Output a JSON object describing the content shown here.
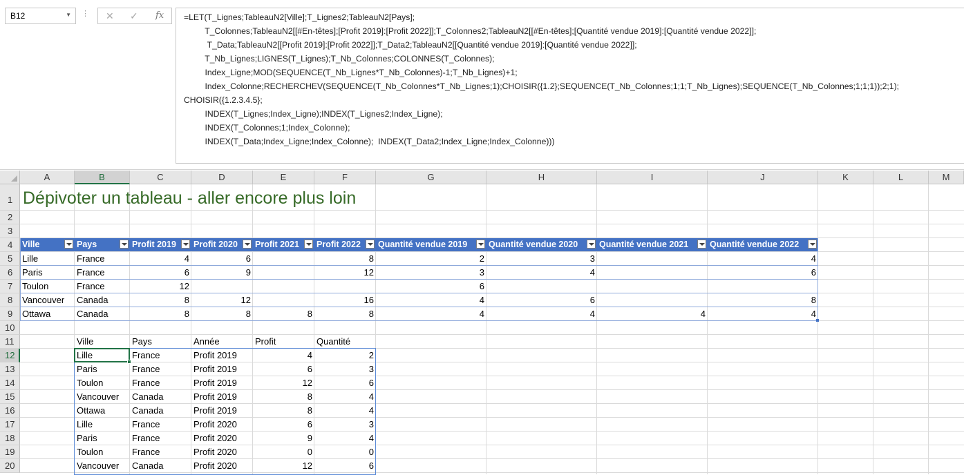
{
  "name_box": "B12",
  "formula_icons": [
    "cancel-x-icon",
    "enter-check-icon",
    "insert-function-icon"
  ],
  "formula_lines": [
    "=LET(T_Lignes;TableauN2[Ville];T_Lignes2;TableauN2[Pays];",
    "         T_Colonnes;TableauN2[[#En-têtes];[Profit 2019]:[Profit 2022]];T_Colonnes2;TableauN2[[#En-têtes];[Quantité vendue 2019]:[Quantité vendue 2022]];",
    "          T_Data;TableauN2[[Profit 2019]:[Profit 2022]];T_Data2;TableauN2[[Quantité vendue 2019]:[Quantité vendue 2022]];",
    "         T_Nb_Lignes;LIGNES(T_Lignes);T_Nb_Colonnes;COLONNES(T_Colonnes);",
    "         Index_Ligne;MOD(SEQUENCE(T_Nb_Lignes*T_Nb_Colonnes)-1;T_Nb_Lignes)+1;",
    "         Index_Colonne;RECHERCHEV(SEQUENCE(T_Nb_Colonnes*T_Nb_Lignes;1);CHOISIR({1.2};SEQUENCE(T_Nb_Colonnes;1;1;T_Nb_Lignes);SEQUENCE(T_Nb_Colonnes;1;1;1));2;1);",
    "CHOISIR({1.2.3.4.5};",
    "         INDEX(T_Lignes;Index_Ligne);INDEX(T_Lignes2;Index_Ligne);",
    "         INDEX(T_Colonnes;1;Index_Colonne);",
    "         INDEX(T_Data;Index_Ligne;Index_Colonne);  INDEX(T_Data2;Index_Ligne;Index_Colonne)))"
  ],
  "columns": [
    "A",
    "B",
    "C",
    "D",
    "E",
    "F",
    "G",
    "H",
    "I",
    "J",
    "K",
    "L",
    "M"
  ],
  "rows": [
    "1",
    "2",
    "3",
    "4",
    "5",
    "6",
    "7",
    "8",
    "9",
    "10",
    "11",
    "12",
    "13",
    "14",
    "15",
    "16",
    "17",
    "18",
    "19",
    "20"
  ],
  "title": "Dépivoter un tableau - aller encore plus loin",
  "table": {
    "headers": [
      "Ville",
      "Pays",
      "Profit 2019",
      "Profit 2020",
      "Profit 2021",
      "Profit 2022",
      "Quantité vendue 2019",
      "Quantité vendue 2020",
      "Quantité vendue 2021",
      "Quantité vendue 2022"
    ],
    "rows": [
      [
        "Lille",
        "France",
        "4",
        "6",
        "",
        "8",
        "2",
        "3",
        "",
        "4"
      ],
      [
        "Paris",
        "France",
        "6",
        "9",
        "",
        "12",
        "3",
        "4",
        "",
        "6"
      ],
      [
        "Toulon",
        "France",
        "12",
        "",
        "",
        "",
        "6",
        "",
        "",
        ""
      ],
      [
        "Vancouver",
        "Canada",
        "8",
        "12",
        "",
        "16",
        "4",
        "6",
        "",
        "8"
      ],
      [
        "Ottawa",
        "Canada",
        "8",
        "8",
        "8",
        "8",
        "4",
        "4",
        "4",
        "4"
      ]
    ]
  },
  "result": {
    "headers": [
      "Ville",
      "Pays",
      "Année",
      "Profit",
      "Quantité"
    ],
    "rows": [
      [
        "Lille",
        "France",
        "Profit 2019",
        "4",
        "2"
      ],
      [
        "Paris",
        "France",
        "Profit 2019",
        "6",
        "3"
      ],
      [
        "Toulon",
        "France",
        "Profit 2019",
        "12",
        "6"
      ],
      [
        "Vancouver",
        "Canada",
        "Profit 2019",
        "8",
        "4"
      ],
      [
        "Ottawa",
        "Canada",
        "Profit 2019",
        "8",
        "4"
      ],
      [
        "Lille",
        "France",
        "Profit 2020",
        "6",
        "3"
      ],
      [
        "Paris",
        "France",
        "Profit 2020",
        "9",
        "4"
      ],
      [
        "Toulon",
        "France",
        "Profit 2020",
        "0",
        "0"
      ],
      [
        "Vancouver",
        "Canada",
        "Profit 2020",
        "12",
        "6"
      ]
    ]
  }
}
